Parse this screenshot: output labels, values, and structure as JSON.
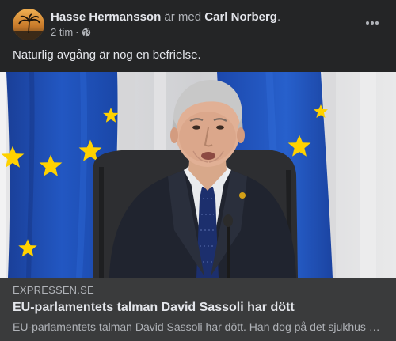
{
  "post": {
    "author": "Hasse Hermansson",
    "with_text": "är med",
    "tagged": "Carl Norberg",
    "period": ".",
    "time": "2 tim",
    "separator": "·",
    "audience_icon": "globe-icon",
    "more_icon": "more-options-icon",
    "text": "Naturlig avgång är nog en befrielse."
  },
  "link": {
    "domain": "EXPRESSEN.SE",
    "title": "EU-parlamentets talman David Sassoli har dött",
    "description": "EU-parlamentets talman David Sassoli har dött. Han dog på det sjukhus där han vårdades.",
    "image_subject": "man-in-suit-at-eu-flags-photo"
  },
  "colors": {
    "background": "#242526",
    "card_meta": "#3a3b3c",
    "primary_text": "#e4e6eb",
    "secondary_text": "#b0b3b8",
    "eu_blue": "#1f4fb0",
    "eu_star": "#ffd200"
  }
}
